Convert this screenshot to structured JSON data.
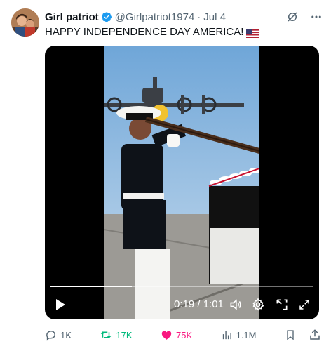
{
  "author": {
    "name": "Girl patriot",
    "handle": "@Girlpatriot1974",
    "separator": "·",
    "date": "Jul 4"
  },
  "tweet": {
    "text": "HAPPY INDEPENDENCE DAY AMERICA!"
  },
  "video": {
    "time": "0:19 / 1:01",
    "progress": 0.31
  },
  "actions": {
    "replies": "1K",
    "reposts": "17K",
    "likes": "75K",
    "views": "1.1M"
  },
  "colors": {
    "text": "#0f1419",
    "secondary": "#536471",
    "verified": "#1d9bf0",
    "repost": "#00ba7c",
    "like": "#f91880"
  }
}
